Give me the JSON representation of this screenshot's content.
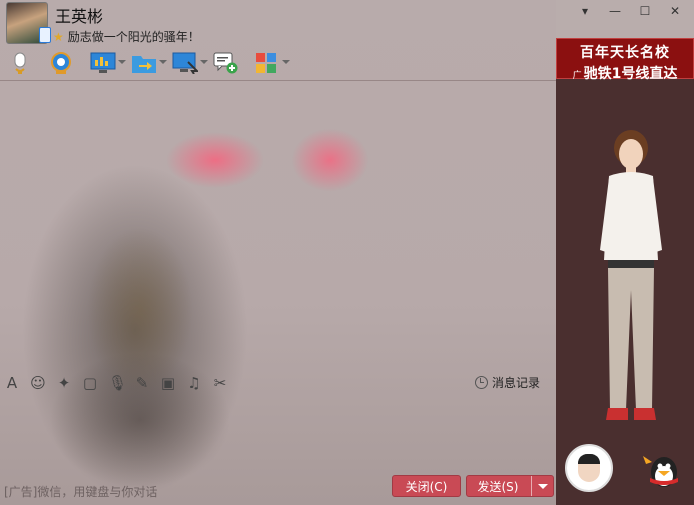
{
  "contact": {
    "name": "王英彬",
    "signature": "励志做一个阳光的骚年！"
  },
  "window_controls": [
    "▾",
    "—",
    "☐",
    "✕"
  ],
  "toolbar": {
    "items": [
      {
        "icon": "microphone-icon"
      },
      {
        "icon": "camera-icon"
      },
      {
        "icon": "screen-share-icon"
      },
      {
        "icon": "file-transfer-icon"
      },
      {
        "icon": "remote-assist-icon"
      },
      {
        "icon": "add-chat-icon"
      },
      {
        "icon": "app-grid-icon"
      }
    ]
  },
  "ad_panel": {
    "line1": "百年天长名校",
    "tag": "广",
    "line2": "驰铁1号线直达"
  },
  "input_toolbar": {
    "history_label": "消息记录"
  },
  "footer": {
    "ad_text": "[广告]微信，用键盘与你对话",
    "close_label": "关闭(C)",
    "send_label": "发送(S)"
  },
  "colors": {
    "accent_button": "#c94a55",
    "ad_banner": "#8b1010"
  }
}
